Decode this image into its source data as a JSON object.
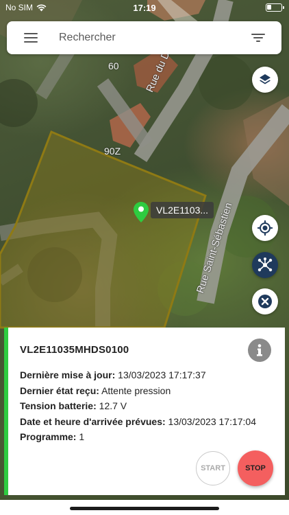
{
  "status_bar": {
    "carrier": "No SIM",
    "time": "17:19",
    "battery_level": 0.3
  },
  "search": {
    "placeholder": "Rechercher",
    "menu_icon": "hamburger-menu-icon",
    "filter_icon": "filter-icon"
  },
  "map": {
    "labels": {
      "number_60": "60",
      "number_90z": "90Z",
      "road_1": "Rue du De",
      "road_2": "Rue Saint-Sébastien"
    },
    "marker": {
      "label": "VL2E1103...",
      "color": "#2ecc40"
    },
    "zone_color": "#8a7a1c",
    "controls": {
      "layers_icon": "layers-icon",
      "locate_icon": "my-location-icon",
      "network_icon": "network-icon",
      "close_icon": "close-icon"
    },
    "control_colors": {
      "primary": "#1f3a5c"
    }
  },
  "panel": {
    "status_color": "#2ecc40",
    "title": "VL2E11035MHDS0100",
    "info_icon": "info-icon",
    "rows": [
      {
        "label": "Dernière mise à jour:",
        "value": "13/03/2023 17:17:37"
      },
      {
        "label": "Dernier état reçu:",
        "value": "Attente pression"
      },
      {
        "label": "Tension batterie:",
        "value": "12.7 V"
      },
      {
        "label": "Date et heure d'arrivée prévues:",
        "value": "13/03/2023 17:17:04"
      },
      {
        "label": "Programme:",
        "value": "1"
      }
    ],
    "start_label": "START",
    "stop_label": "STOP",
    "stop_color": "#f45f5f"
  }
}
